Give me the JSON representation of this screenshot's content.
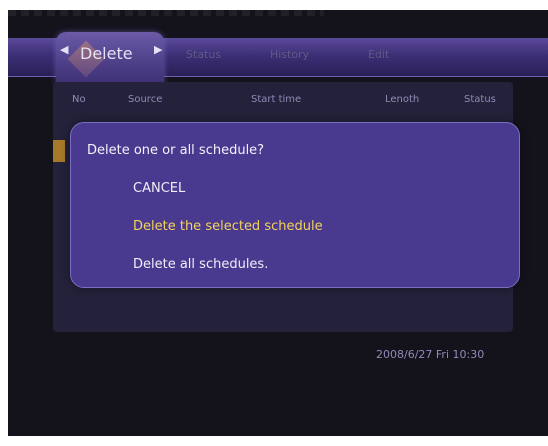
{
  "tabs": {
    "active": "Delete",
    "inactive": [
      "Status",
      "History",
      "Edit"
    ]
  },
  "columns": [
    "No",
    "Source",
    "Start time",
    "Lenoth",
    "Status"
  ],
  "dialog": {
    "prompt": "Delete one or all schedule?",
    "options": [
      {
        "label": "CANCEL",
        "selected": false
      },
      {
        "label": "Delete the selected schedule",
        "selected": true
      },
      {
        "label": "Delete all schedules.",
        "selected": false
      }
    ]
  },
  "datetime": "2008/6/27 Fri 10:30",
  "colors": {
    "accent": "#4a3a8f",
    "selected_text": "#f3d25a",
    "background": "#14131c"
  },
  "icons": [
    "left-arrow-icon",
    "right-arrow-icon",
    "delete-tab-icon"
  ]
}
